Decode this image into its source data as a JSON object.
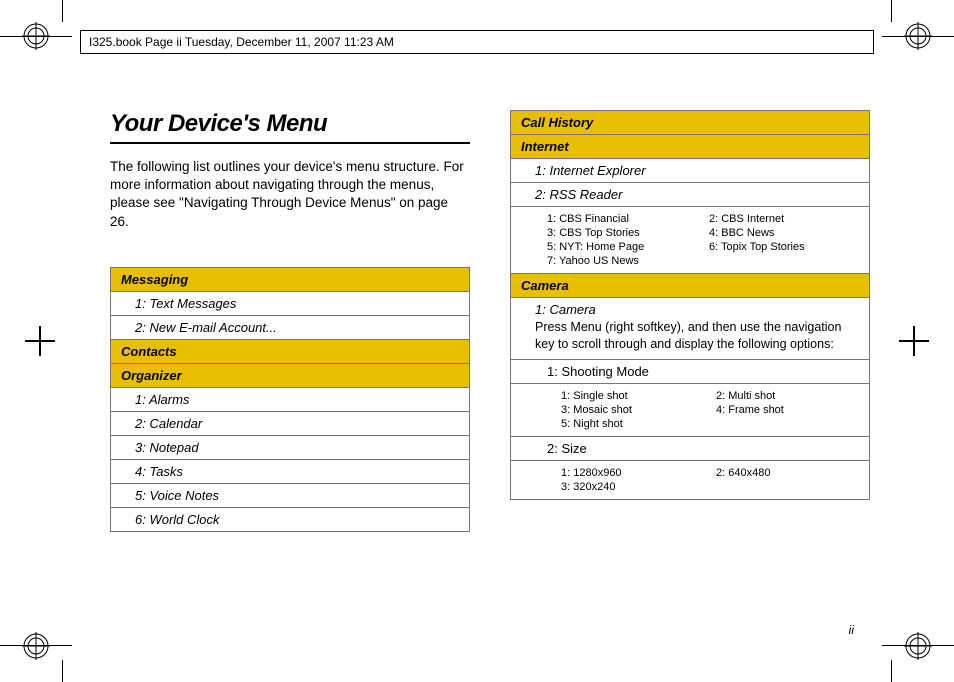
{
  "header": {
    "text": "I325.book  Page ii  Tuesday, December 11, 2007  11:23 AM"
  },
  "title": "Your Device's Menu",
  "intro": "The following list outlines your device's menu structure. For more information about navigating through the menus, please see \"Navigating Through Device Menus\" on page 26.",
  "left": {
    "messaging": {
      "label": "Messaging",
      "items": {
        "i1": "1: Text Messages",
        "i2": "2: New E-mail Account..."
      }
    },
    "contacts": {
      "label": "Contacts"
    },
    "organizer": {
      "label": "Organizer",
      "items": {
        "i1": "1: Alarms",
        "i2": "2: Calendar",
        "i3": "3: Notepad",
        "i4": "4: Tasks",
        "i5": "5: Voice Notes",
        "i6": "6: World Clock"
      }
    }
  },
  "right": {
    "callhistory": {
      "label": "Call History"
    },
    "internet": {
      "label": "Internet",
      "items": {
        "i1": "1: Internet Explorer",
        "i2": "2: RSS Reader"
      },
      "rss": {
        "c1": "1: CBS Financial",
        "c2": "2: CBS Internet",
        "c3": "3: CBS Top Stories",
        "c4": "4: BBC News",
        "c5": "5: NYT: Home Page",
        "c6": "6: Topix Top Stories",
        "c7": "7: Yahoo US News"
      }
    },
    "camera": {
      "label": "Camera",
      "camtitle": "1: Camera",
      "note": "Press Menu (right softkey), and then use the navigation key to scroll through and display the following options:",
      "shooting": {
        "label": "1: Shooting Mode",
        "opts": {
          "o1": "1: Single shot",
          "o2": "2: Multi shot",
          "o3": "3: Mosaic shot",
          "o4": "4: Frame shot",
          "o5": "5: Night shot"
        }
      },
      "size": {
        "label": "2: Size",
        "opts": {
          "o1": "1: 1280x960",
          "o2": "2: 640x480",
          "o3": "3: 320x240"
        }
      }
    }
  },
  "pagenum": "ii"
}
